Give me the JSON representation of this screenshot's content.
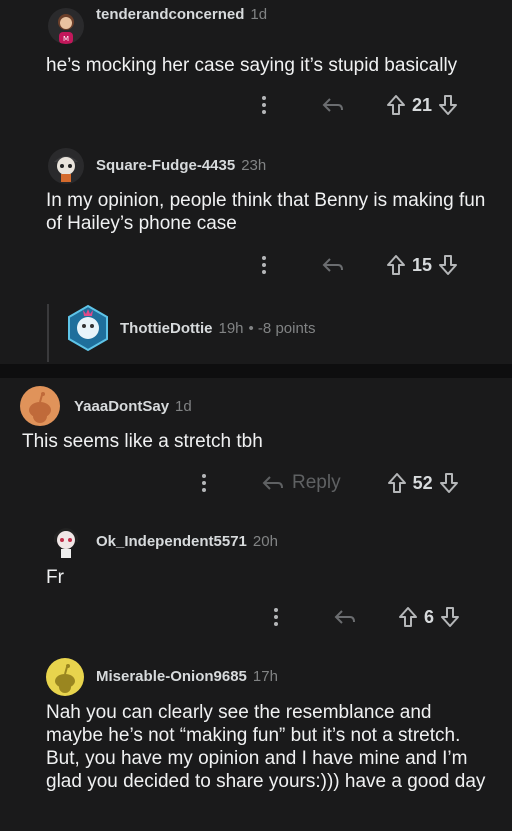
{
  "comments": [
    {
      "user": "tenderandconcerned",
      "time": "1d",
      "text": "he’s mocking her case saying it’s stupid basically",
      "score": "21"
    },
    {
      "user": "Square-Fudge-4435",
      "time": "23h",
      "text": "In my opinion, people think that Benny is making fun of Hailey’s phone case",
      "score": "15"
    },
    {
      "user": "ThottieDottie",
      "time": "19h",
      "collapsed_info": "• -8 points"
    },
    {
      "user": "YaaaDontSay",
      "time": "1d",
      "text": "This seems like a stretch tbh",
      "reply_label": "Reply",
      "score": "52"
    },
    {
      "user": "Ok_Independent5571",
      "time": "20h",
      "text": "Fr",
      "score": "6"
    },
    {
      "user": "Miserable-Onion9685",
      "time": "17h",
      "text": "Nah you can clearly see the resemblance and maybe he’s not “making fun” but it’s not a stretch. But, you have my opinion and I have mine and I’m glad you decided to share yours:))) have a good day"
    }
  ],
  "colors": {
    "background": "#1a1a1b",
    "divider": "#0e0e0f",
    "snoo_orange": "#e0935a",
    "snoo_yellow": "#e8d44d"
  }
}
